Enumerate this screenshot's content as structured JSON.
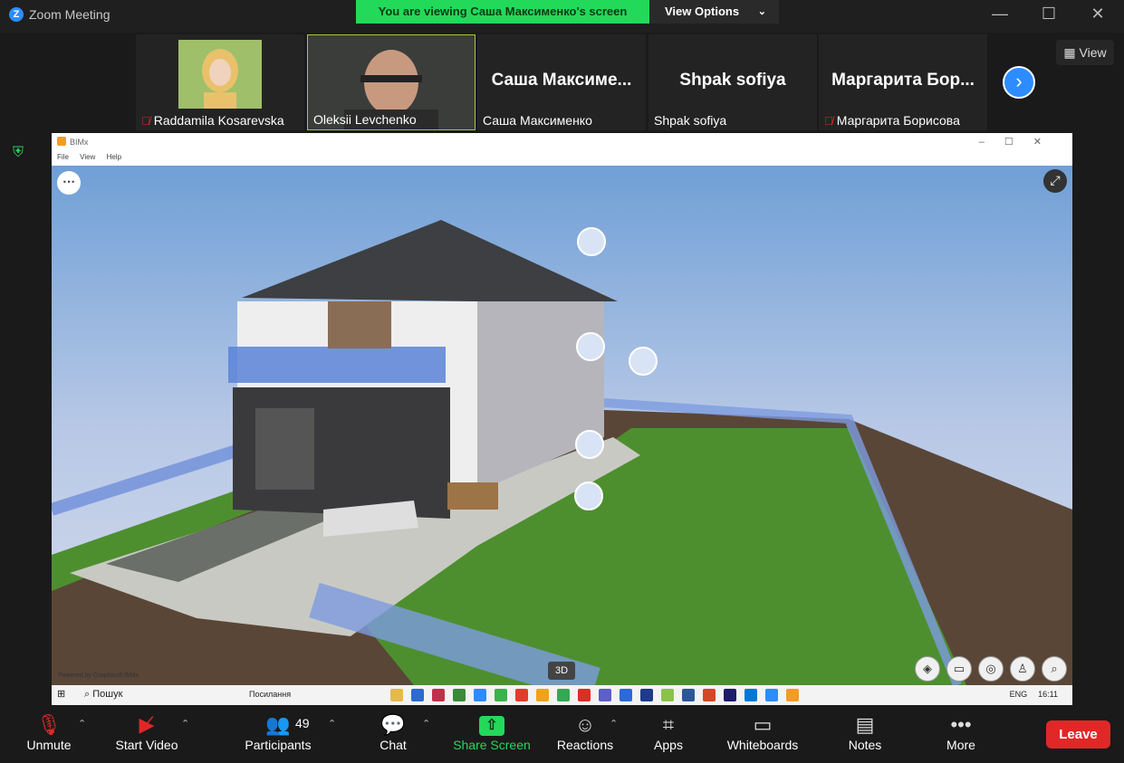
{
  "window": {
    "title": "Zoom Meeting",
    "banner": "You are viewing Саша Максименко's screen",
    "view_options": "View Options",
    "minimize": "—",
    "maximize": "☐",
    "close": "✕"
  },
  "participants_strip": {
    "tiles": [
      {
        "name": "Raddamila Kosarevska",
        "muted": true,
        "has_video": true
      },
      {
        "name": "Oleksii Levchenko",
        "muted": false,
        "has_video": true,
        "active": true
      },
      {
        "name": "Саша Максименко",
        "display": "Саша Максиме...",
        "muted": false,
        "has_video": false
      },
      {
        "name": "Shpak sofiya",
        "display": "Shpak sofiya",
        "muted": false,
        "has_video": false
      },
      {
        "name": "Маргарита Борисова",
        "display": "Маргарита Бор...",
        "muted": true,
        "has_video": false
      }
    ],
    "view_label": "View"
  },
  "shared_app": {
    "title": "BIMx",
    "menu": [
      "File",
      "View",
      "Help"
    ],
    "powered": "Powered by Graphisoft BIMx",
    "mode_badge": "3D",
    "taskbar": {
      "search": "Пошук",
      "link": "Посилання",
      "lang": "ENG",
      "time": "16:11"
    }
  },
  "toolbar": {
    "unmute": "Unmute",
    "start_video": "Start Video",
    "participants": "Participants",
    "participants_count": "49",
    "chat": "Chat",
    "share_screen": "Share Screen",
    "reactions": "Reactions",
    "apps": "Apps",
    "whiteboards": "Whiteboards",
    "notes": "Notes",
    "more": "More",
    "leave": "Leave"
  }
}
